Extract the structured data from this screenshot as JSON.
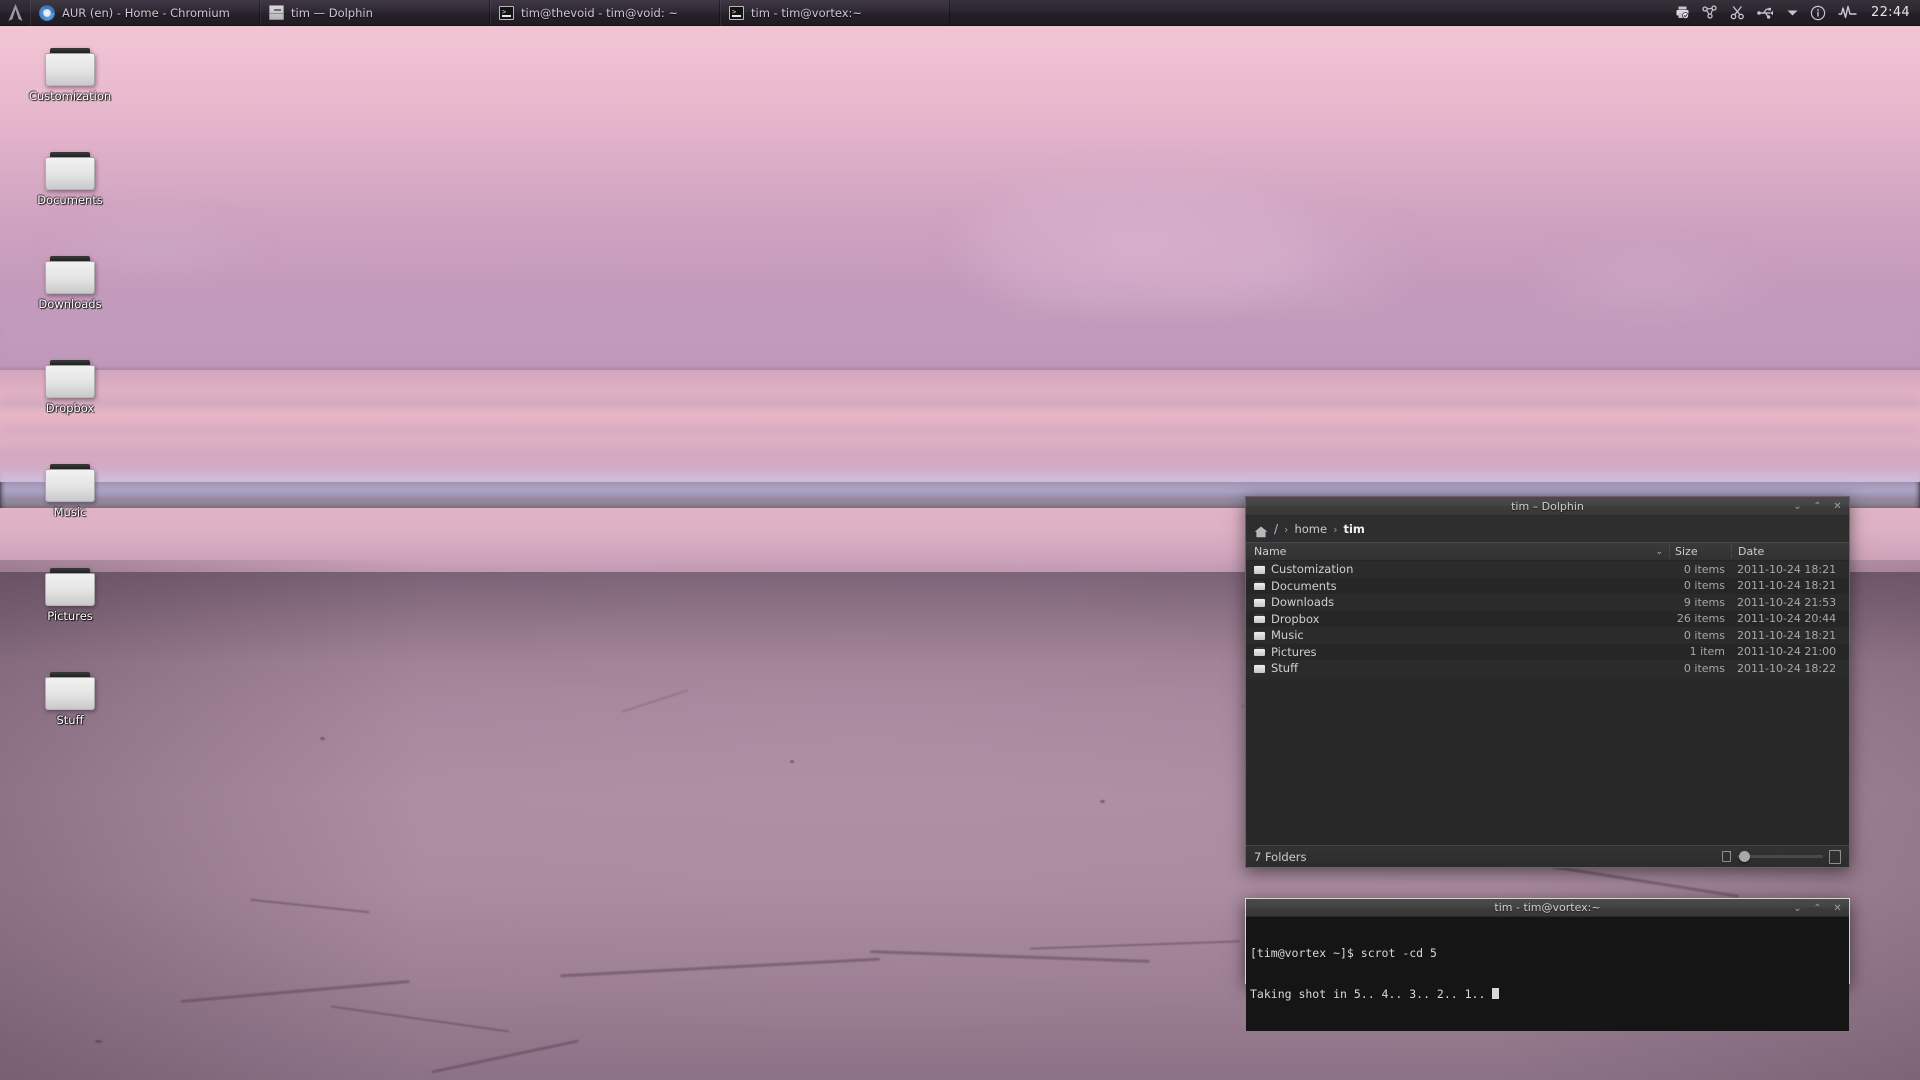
{
  "taskbar": {
    "launcher_icon": "arch-logo-icon",
    "tasks": [
      {
        "label": "AUR (en) - Home - Chromium",
        "icon": "chromium-icon"
      },
      {
        "label": "tim — Dolphin",
        "icon": "file-cabinet-icon"
      },
      {
        "label": "tim@thevoid - tim@void: ~",
        "icon": "terminal-icon"
      },
      {
        "label": "tim - tim@vortex:~",
        "icon": "terminal-icon"
      }
    ],
    "tray": [
      {
        "name": "printer-icon",
        "glyph": "⎙"
      },
      {
        "name": "network-icon",
        "glyph": "⚭"
      },
      {
        "name": "scissors-icon",
        "glyph": "✂"
      },
      {
        "name": "usb-icon",
        "glyph": "⑂"
      },
      {
        "name": "chevron-down-icon",
        "glyph": "▾"
      },
      {
        "name": "info-icon",
        "glyph": "ⓘ"
      },
      {
        "name": "activity-monitor-icon",
        "glyph": "⌇"
      }
    ],
    "clock": "22:44"
  },
  "desktop": {
    "icons": [
      {
        "label": "Customization"
      },
      {
        "label": "Documents"
      },
      {
        "label": "Downloads"
      },
      {
        "label": "Dropbox"
      },
      {
        "label": "Music"
      },
      {
        "label": "Pictures"
      },
      {
        "label": "Stuff"
      }
    ]
  },
  "dolphin": {
    "title": "tim – Dolphin",
    "window_buttons": {
      "minimize": "⌄",
      "maximize": "⌃",
      "close": "✕"
    },
    "breadcrumb": {
      "home_icon": "home-icon",
      "root": "/",
      "items": [
        {
          "label": "home",
          "active": false
        },
        {
          "label": "tim",
          "active": true
        }
      ],
      "separator": "›"
    },
    "columns": {
      "name": "Name",
      "size": "Size",
      "date": "Date",
      "sort_indicator": "⌄"
    },
    "files": [
      {
        "name": "Customization",
        "size": "0 items",
        "date": "2011-10-24 18:21"
      },
      {
        "name": "Documents",
        "size": "0 items",
        "date": "2011-10-24 18:21"
      },
      {
        "name": "Downloads",
        "size": "9 items",
        "date": "2011-10-24 21:53"
      },
      {
        "name": "Dropbox",
        "size": "26 items",
        "date": "2011-10-24 20:44"
      },
      {
        "name": "Music",
        "size": "0 items",
        "date": "2011-10-24 18:21"
      },
      {
        "name": "Pictures",
        "size": "1 item",
        "date": "2011-10-24 21:00"
      },
      {
        "name": "Stuff",
        "size": "0 items",
        "date": "2011-10-24 18:22"
      }
    ],
    "status": "7 Folders",
    "zoom_percent": 8
  },
  "terminal": {
    "title": "tim - tim@vortex:~",
    "window_buttons": {
      "minimize": "⌄",
      "maximize": "⌃",
      "close": "✕"
    },
    "lines": [
      "[tim@vortex ~]$ scrot -cd 5",
      "Taking shot in 5.. 4.. 3.. 2.. 1.. "
    ]
  },
  "colors": {
    "taskbar_bg": "#2b262f",
    "window_chrome": "#434343",
    "dolphin_bg": "#2e2e2e",
    "terminal_bg": "#151515",
    "accent_border": "#6f5d6d"
  }
}
